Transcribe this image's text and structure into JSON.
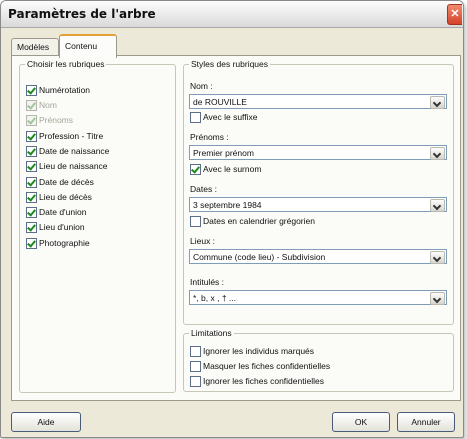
{
  "window": {
    "title": "Paramètres de l'arbre",
    "close_glyph": "✕"
  },
  "tabs": [
    {
      "label": "Modèles",
      "active": false
    },
    {
      "label": "Contenu",
      "active": true
    }
  ],
  "left_group": {
    "legend": "Choisir les rubriques",
    "items": [
      {
        "label": "Numérotation",
        "checked": true,
        "disabled": false
      },
      {
        "label": "Nom",
        "checked": true,
        "disabled": true
      },
      {
        "label": "Prénoms",
        "checked": true,
        "disabled": true
      },
      {
        "label": "Profession - Titre",
        "checked": true,
        "disabled": false
      },
      {
        "label": "Date de naissance",
        "checked": true,
        "disabled": false
      },
      {
        "label": "Lieu de naissance",
        "checked": true,
        "disabled": false
      },
      {
        "label": "Date de décès",
        "checked": true,
        "disabled": false
      },
      {
        "label": "Lieu de décès",
        "checked": true,
        "disabled": false
      },
      {
        "label": "Date d'union",
        "checked": true,
        "disabled": false
      },
      {
        "label": "Lieu d'union",
        "checked": true,
        "disabled": false
      },
      {
        "label": "Photographie",
        "checked": true,
        "disabled": false
      }
    ]
  },
  "styles_group": {
    "legend": "Styles des rubriques",
    "nom": {
      "label": "Nom :",
      "value": "de ROUVILLE",
      "option_label": "Avec le suffixe",
      "option_checked": false
    },
    "prenoms": {
      "label": "Prénoms :",
      "value": "Premier prénom",
      "option_label": "Avec le surnom",
      "option_checked": true
    },
    "dates": {
      "label": "Dates :",
      "value": "3 septembre 1984",
      "option_label": "Dates en calendrier grégorien",
      "option_checked": false
    },
    "lieux": {
      "label": "Lieux :",
      "value": "Commune (code lieu) - Subdivision"
    },
    "intitules": {
      "label": "Intitulés :",
      "value": "*, b, x , † ..."
    }
  },
  "limitations_group": {
    "legend": "Limitations",
    "items": [
      {
        "label": "Ignorer les individus marqués",
        "checked": false
      },
      {
        "label": "Masquer les fiches confidentielles",
        "checked": false
      },
      {
        "label": "Ignorer les fiches confidentielles",
        "checked": false
      }
    ]
  },
  "buttons": {
    "help": "Aide",
    "ok": "OK",
    "cancel": "Annuler"
  }
}
